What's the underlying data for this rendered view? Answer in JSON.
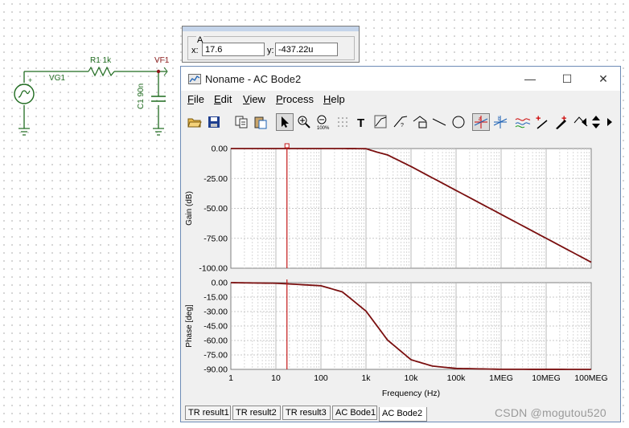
{
  "schematic": {
    "source_label": "VG1",
    "resistor_label": "R1 1k",
    "capacitor_label": "C1 90n",
    "probe_label": "VF1"
  },
  "cursor_panel": {
    "group_title": "A",
    "x_label": "x:",
    "x_value": "17.6",
    "y_label": "y:",
    "y_value": "-437.22u"
  },
  "window": {
    "title": "Noname - AC Bode2",
    "controls": {
      "minimize": "—",
      "maximize": "☐",
      "close": "✕"
    }
  },
  "menu": [
    {
      "key": "F",
      "rest": "ile"
    },
    {
      "key": "E",
      "rest": "dit"
    },
    {
      "key": "V",
      "rest": "iew"
    },
    {
      "key": "P",
      "rest": "rocess"
    },
    {
      "key": "H",
      "rest": "elp"
    }
  ],
  "toolbar": {
    "icons": [
      "open-folder-icon",
      "save-disk-icon",
      "copy-icon",
      "paste-icon",
      "select-arrow-icon",
      "zoom-in-icon",
      "zoom-out-100-icon",
      "grid-dots-icon",
      "text-tool-icon",
      "curve-tool-a-icon",
      "curve-tool-b-icon",
      "curve-tool-c-icon",
      "line-tool-icon",
      "circle-tool-icon",
      "cursor-a-icon",
      "cursor-b-icon",
      "waveform-icon",
      "probe-add-icon",
      "probe-pen-icon",
      "slope-icon",
      "scroll-left-icon",
      "scroll-updown-icon",
      "scroll-right-icon"
    ]
  },
  "chart_data": [
    {
      "type": "line",
      "ylabel": "Gain (dB)",
      "xscale": "log",
      "xlim": [
        1,
        100000000
      ],
      "ylim": [
        -100,
        0
      ],
      "yticks": [
        "0.00",
        "-25.00",
        "-50.00",
        "-75.00",
        "-100.00"
      ],
      "grid": true,
      "series": [
        {
          "color": "#7a0f0f",
          "x": [
            1,
            100,
            500,
            1000,
            1768,
            3000,
            10000,
            100000,
            1000000,
            10000000,
            100000000
          ],
          "y": [
            0.0,
            0.0,
            -0.03,
            -0.13,
            -3.0,
            -5.3,
            -15.0,
            -35.0,
            -55.0,
            -75.0,
            -95.0
          ]
        }
      ],
      "cursor": {
        "x": 17.6
      }
    },
    {
      "type": "line",
      "ylabel": "Phase [deg]",
      "xlabel": "Frequency (Hz)",
      "xscale": "log",
      "xlim": [
        1,
        100000000
      ],
      "ylim": [
        -90,
        0
      ],
      "yticks": [
        "0.00",
        "-15.00",
        "-30.00",
        "-45.00",
        "-60.00",
        "-75.00",
        "-90.00"
      ],
      "xticks": [
        "1",
        "10",
        "100",
        "1k",
        "10k",
        "100k",
        "1MEG",
        "10MEG",
        "100MEG"
      ],
      "grid": true,
      "series": [
        {
          "color": "#7a0f0f",
          "x": [
            1,
            10,
            100,
            300,
            1000,
            1768,
            3000,
            10000,
            30000,
            100000,
            1000000,
            100000000
          ],
          "y": [
            0.0,
            -0.6,
            -3.2,
            -9.6,
            -29.5,
            -45.0,
            -59.5,
            -80.0,
            -86.6,
            -89.0,
            -89.9,
            -90.0
          ]
        }
      ],
      "cursor": {
        "x": 17.6
      }
    }
  ],
  "tabs": [
    "TR result1",
    "TR result2",
    "TR result3",
    "AC Bode1",
    "AC Bode2"
  ],
  "active_tab": "AC Bode2",
  "watermark": "CSDN @mogutou520"
}
